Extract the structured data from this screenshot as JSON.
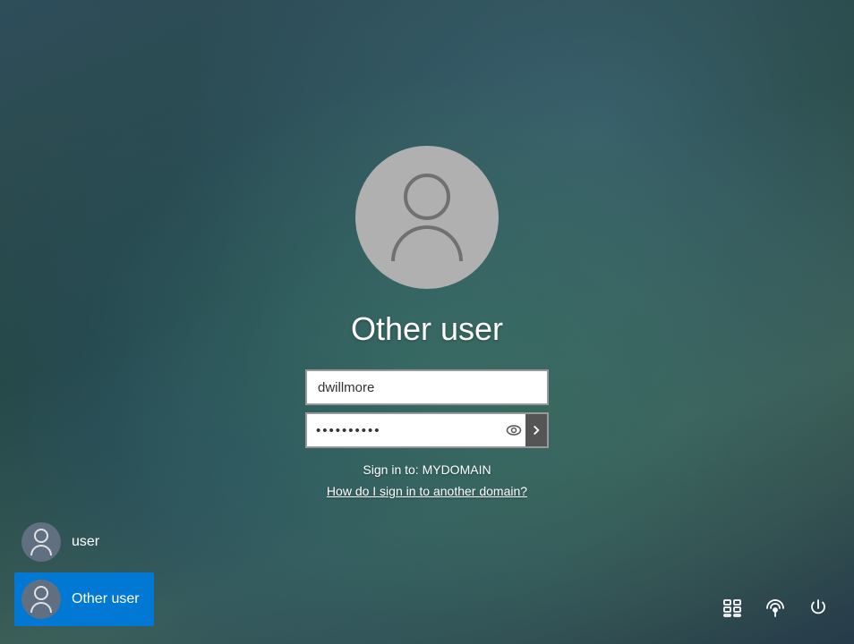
{
  "background": {
    "alt": "Windows login background"
  },
  "main": {
    "user_display_name": "Other user",
    "username_value": "dwillmore",
    "password_value": "••••••••••",
    "password_placeholder": "",
    "sign_in_to_label": "Sign in to: MYDOMAIN",
    "how_to_sign_in_label": "How do I sign in to another domain?"
  },
  "user_list": [
    {
      "id": "user",
      "label": "user",
      "active": false
    },
    {
      "id": "other-user",
      "label": "Other user",
      "active": true
    }
  ],
  "bottom_buttons": [
    {
      "id": "accessibility",
      "icon": "accessibility-icon",
      "label": "Accessibility"
    },
    {
      "id": "network",
      "icon": "network-icon",
      "label": "Network"
    },
    {
      "id": "power",
      "icon": "power-icon",
      "label": "Power"
    }
  ]
}
